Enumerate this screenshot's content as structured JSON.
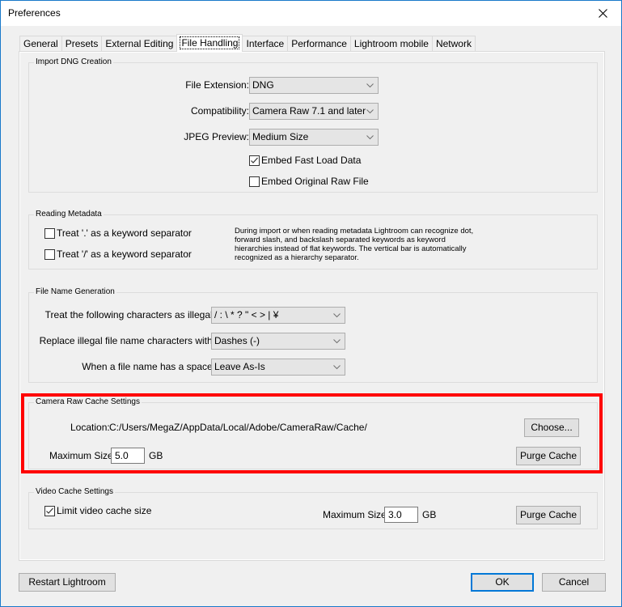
{
  "window": {
    "title": "Preferences",
    "close_icon": "close-icon"
  },
  "tabs": [
    {
      "label": "General",
      "active": false
    },
    {
      "label": "Presets",
      "active": false
    },
    {
      "label": "External Editing",
      "active": false
    },
    {
      "label": "File Handling",
      "active": true
    },
    {
      "label": "Interface",
      "active": false
    },
    {
      "label": "Performance",
      "active": false
    },
    {
      "label": "Lightroom mobile",
      "active": false
    },
    {
      "label": "Network",
      "active": false
    }
  ],
  "import_dng": {
    "legend": "Import DNG Creation",
    "file_extension": {
      "label": "File Extension:",
      "value": "DNG"
    },
    "compatibility": {
      "label": "Compatibility:",
      "value": "Camera Raw 7.1 and later"
    },
    "jpeg_preview": {
      "label": "JPEG Preview:",
      "value": "Medium Size"
    },
    "embed_fast_load": {
      "label": "Embed Fast Load Data",
      "checked": true
    },
    "embed_original_raw": {
      "label": "Embed Original Raw File",
      "checked": false
    }
  },
  "reading_metadata": {
    "legend": "Reading Metadata",
    "treat_dot": {
      "label": "Treat '.' as a keyword separator",
      "checked": false
    },
    "treat_slash": {
      "label": "Treat '/' as a keyword separator",
      "checked": false
    },
    "description": "During import or when reading metadata Lightroom can recognize dot, forward slash, and backslash separated keywords as keyword hierarchies instead of flat keywords. The vertical bar is automatically recognized as a hierarchy separator."
  },
  "file_name_generation": {
    "legend": "File Name Generation",
    "illegal_chars": {
      "label": "Treat the following characters as illegal:",
      "value": "/ : \\ * ? \" < > | ¥"
    },
    "replace_with": {
      "label": "Replace illegal file name characters with:",
      "value": "Dashes (-)"
    },
    "space_handling": {
      "label": "When a file name has a space:",
      "value": "Leave As-Is"
    }
  },
  "camera_raw_cache": {
    "legend": "Camera Raw Cache Settings",
    "location_label": "Location:",
    "location_value": "C:/Users/MegaZ/AppData/Local/Adobe/CameraRaw/Cache/",
    "choose_button": "Choose...",
    "max_size_label": "Maximum Size:",
    "max_size_value": "5.0",
    "max_size_unit": "GB",
    "purge_button": "Purge Cache",
    "highlight_color": "#ff0000"
  },
  "video_cache": {
    "legend": "Video Cache Settings",
    "limit": {
      "label": "Limit video cache size",
      "checked": true
    },
    "max_size_label": "Maximum Size:",
    "max_size_value": "3.0",
    "max_size_unit": "GB",
    "purge_button": "Purge Cache"
  },
  "footer": {
    "restart_button": "Restart Lightroom",
    "ok_button": "OK",
    "cancel_button": "Cancel"
  },
  "colors": {
    "accent": "#0078d7",
    "window_border": "#1979ca",
    "background": "#f0f0f0"
  }
}
